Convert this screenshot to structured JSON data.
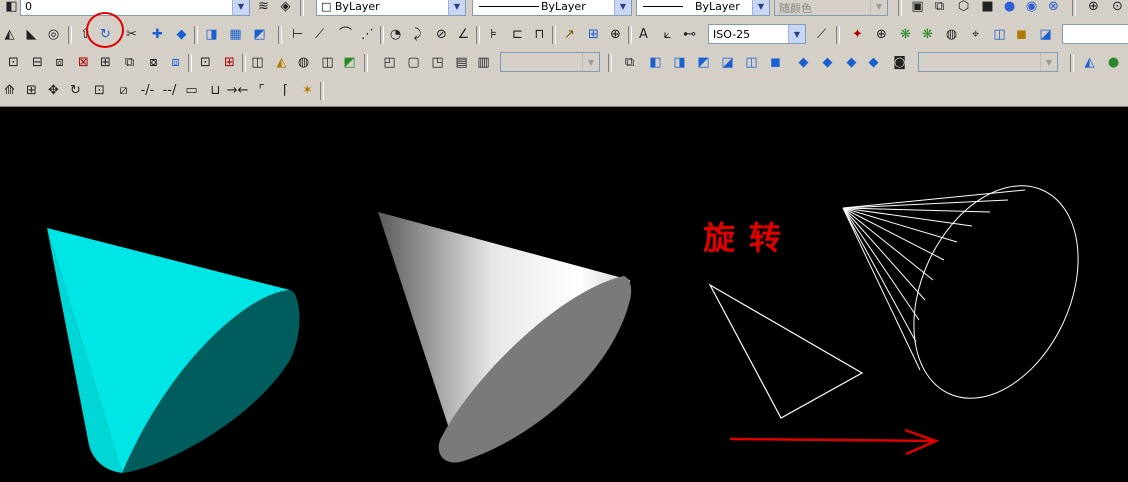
{
  "toolbar": {
    "layer_combo": {
      "value": "0"
    },
    "color_combo": {
      "value": "ByLayer"
    },
    "linetype_combo": {
      "value": "ByLayer"
    },
    "lineweight_combo": {
      "value": "ByLayer"
    },
    "plotstyle_combo": {
      "value": "随颜色"
    },
    "dimstyle_combo": {
      "value": "ISO-25"
    }
  },
  "drawing": {
    "annotation": "旋转",
    "colors": {
      "cyan": "#00e5e5",
      "dark_cyan": "#005f5f",
      "wire": "#ffffff",
      "accent": "#e00000"
    }
  }
}
